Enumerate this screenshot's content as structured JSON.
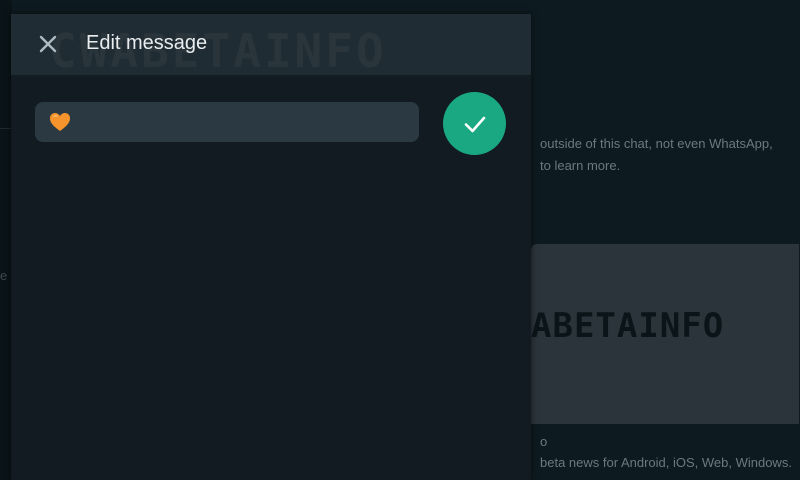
{
  "panel": {
    "title": "Edit message",
    "watermark": "CWABETAINFO",
    "message_value": "🧡",
    "close_icon": "close-icon",
    "confirm_icon": "check-icon"
  },
  "background": {
    "left_glyph": "e",
    "line1": "outside of this chat, not even WhatsApp,",
    "line2": "to learn more.",
    "card_logo": "ABETAINFO",
    "line3": "o",
    "line4": "beta news for Android, iOS, Web, Windows."
  },
  "colors": {
    "accent": "#1aa882",
    "panel_bg": "#111b21",
    "header_bg": "#202c33",
    "field_bg": "#2a3942",
    "heart": "#f5942c"
  }
}
